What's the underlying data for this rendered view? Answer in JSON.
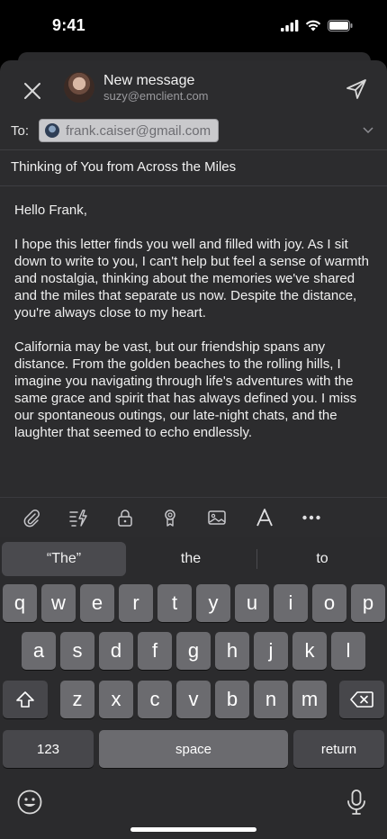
{
  "status": {
    "time": "9:41"
  },
  "header": {
    "title": "New message",
    "account": "suzy@emclient.com"
  },
  "to": {
    "label": "To:",
    "recipient": "frank.caiser@gmail.com"
  },
  "subject": "Thinking of You from Across the Miles",
  "body": {
    "greeting": "Hello Frank,",
    "paragraph1": "I hope this letter finds you well and filled with joy. As I sit down to write to you, I can't help but feel a sense of warmth and nostalgia, thinking about the memories we've shared and the miles that separate us now. Despite the distance, you're always close to my heart.",
    "paragraph2": "California may be vast, but our friendship spans any distance. From the golden beaches to the rolling hills, I imagine you navigating through life's adventures with the same grace and spirit that has always defined you. I miss our spontaneous outings, our late-night chats, and the laughter that seemed to echo endlessly."
  },
  "toolbar": [
    "paperclip-icon",
    "quick-text-icon",
    "lock-icon",
    "certificate-icon",
    "image-icon",
    "text-format-icon",
    "more-icon"
  ],
  "keyboard": {
    "suggestions": [
      "“The”",
      "the",
      "to"
    ],
    "row1": [
      "q",
      "w",
      "e",
      "r",
      "t",
      "y",
      "u",
      "i",
      "o",
      "p"
    ],
    "row2": [
      "a",
      "s",
      "d",
      "f",
      "g",
      "h",
      "j",
      "k",
      "l"
    ],
    "row3": [
      "z",
      "x",
      "c",
      "v",
      "b",
      "n",
      "m"
    ],
    "numbers_label": "123",
    "space_label": "space",
    "return_label": "return"
  },
  "colors": {
    "background": "#000000",
    "sheet": "#2c2c2e",
    "key": "#6b6b6f",
    "key_dark": "#47474b",
    "chip": "#c9c9cc"
  }
}
